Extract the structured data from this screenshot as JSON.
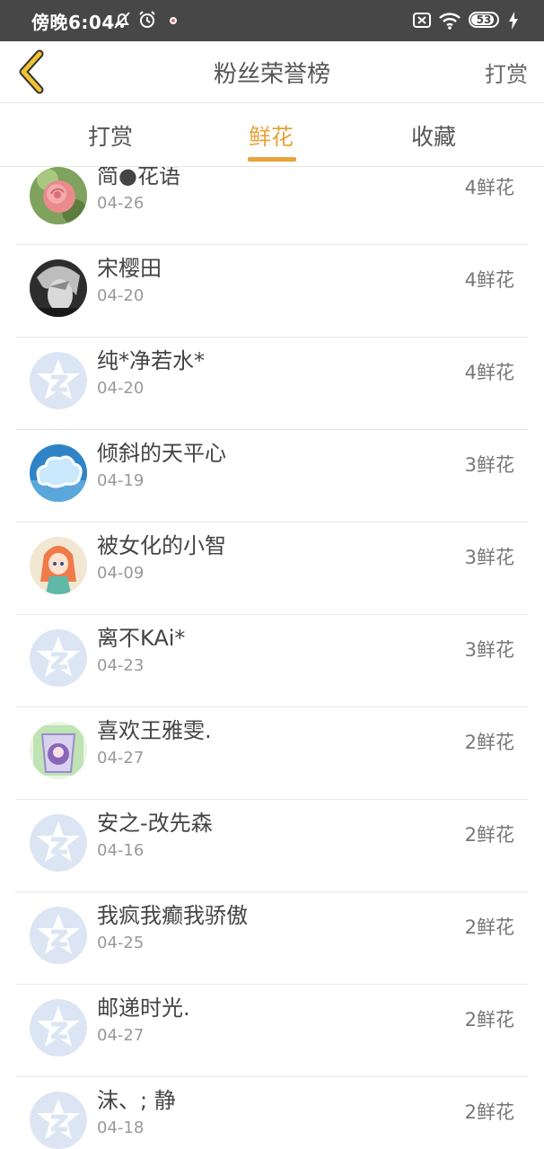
{
  "status_bar": {
    "time": "傍晚6:04",
    "battery": "53"
  },
  "header": {
    "title": "粉丝荣誉榜",
    "action_label": "打赏"
  },
  "tabs": [
    {
      "label": "打赏",
      "active": false
    },
    {
      "label": "鲜花",
      "active": true
    },
    {
      "label": "收藏",
      "active": false
    }
  ],
  "list": [
    {
      "name": "简●花语",
      "date": "04-26",
      "count": "4鲜花",
      "avatar": "rose-photo"
    },
    {
      "name": "宋樱田",
      "date": "04-20",
      "count": "4鲜花",
      "avatar": "anime-boy-gray"
    },
    {
      "name": "纯*净若水*",
      "date": "04-20",
      "count": "4鲜花",
      "avatar": "default-star"
    },
    {
      "name": "倾斜的天平心",
      "date": "04-19",
      "count": "3鲜花",
      "avatar": "sky-cloud"
    },
    {
      "name": "被女化的小智",
      "date": "04-09",
      "count": "3鲜花",
      "avatar": "anime-girl-pink"
    },
    {
      "name": "离不KAi*",
      "date": "04-23",
      "count": "3鲜花",
      "avatar": "default-star"
    },
    {
      "name": "喜欢王雅雯.",
      "date": "04-27",
      "count": "2鲜花",
      "avatar": "anime-purple-cup"
    },
    {
      "name": "安之-改先森",
      "date": "04-16",
      "count": "2鲜花",
      "avatar": "default-star"
    },
    {
      "name": "我疯我癫我骄傲",
      "date": "04-25",
      "count": "2鲜花",
      "avatar": "default-star"
    },
    {
      "name": "邮递时光.",
      "date": "04-27",
      "count": "2鲜花",
      "avatar": "default-star"
    },
    {
      "name": "沫、; 静",
      "date": "04-18",
      "count": "2鲜花",
      "avatar": "default-star"
    }
  ],
  "colors": {
    "accent": "#e8a33a",
    "status_bar": "#474747"
  }
}
